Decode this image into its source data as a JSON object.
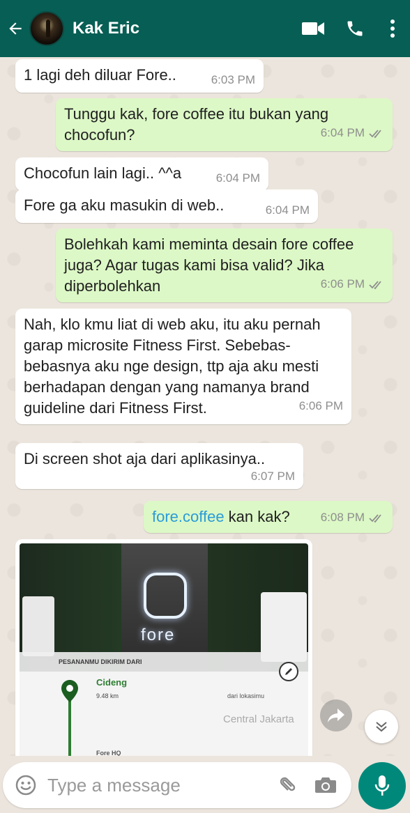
{
  "header": {
    "title": "Kak Eric",
    "icons": [
      "back-arrow-icon",
      "video-call-icon",
      "phone-icon",
      "more-vert-icon"
    ],
    "color": "#075e54"
  },
  "messages": [
    {
      "dir": "in",
      "text": "1 lagi deh diluar Fore..",
      "time": "6:03 PM"
    },
    {
      "dir": "out",
      "text": "Tunggu kak, fore coffee itu bukan yang chocofun?",
      "time": "6:04 PM"
    },
    {
      "dir": "in",
      "text": "Chocofun lain lagi.. ^^a",
      "time": "6:04 PM"
    },
    {
      "dir": "in",
      "text": "Fore ga aku masukin di web..",
      "time": "6:04 PM"
    },
    {
      "dir": "out",
      "text": "Bolehkah kami meminta desain fore coffee juga? Agar tugas kami bisa valid? Jika diperbolehkan",
      "time": "6:06 PM"
    },
    {
      "dir": "in",
      "text": "Nah, klo kmu liat di web aku, itu aku pernah garap microsite Fitness First. Sebebas-bebasnya aku nge design, ttp aja aku mesti berhadapan dengan yang namanya brand guideline dari Fitness First.",
      "time": "6:06 PM"
    },
    {
      "dir": "in",
      "text": "Di screen shot aja dari aplikasinya..",
      "time": "6:07 PM"
    },
    {
      "dir": "out",
      "link": "fore.coffee",
      "text": " kan kak?",
      "time": "6:08 PM"
    }
  ],
  "image_message": {
    "logo_text": "fore",
    "banner": "PESANANMU DIKIRIM DARI",
    "location_name": "Cideng",
    "distance": "9.48 km",
    "from_label": "dari lokasimu",
    "area": "Central Jakarta",
    "next_stop": "Fore HQ"
  },
  "input": {
    "placeholder": "Type a message",
    "icons": [
      "emoji-icon",
      "attach-icon",
      "camera-icon",
      "mic-icon"
    ]
  },
  "colors": {
    "incoming": "#ffffff",
    "outgoing": "#dcf8c6",
    "accent": "#00897b",
    "link": "#2a9bd8"
  }
}
